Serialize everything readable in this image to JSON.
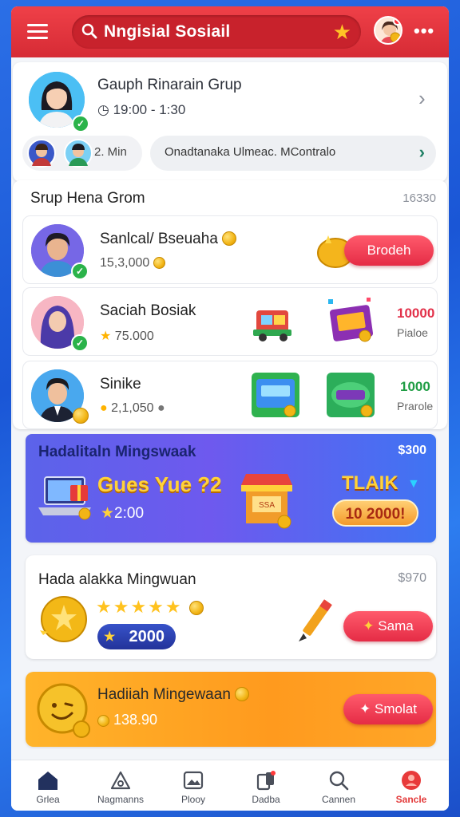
{
  "header": {
    "search_text": "Nngisial Sosiail"
  },
  "group": {
    "title": "Gauph Rinarain Grup",
    "time": "19:00 - 1:30",
    "mini_text": "2. Min",
    "notice": "Onadtanaka Ulmeac. MContralo"
  },
  "ranking": {
    "title": "Srup Hena Grom",
    "count": "16330",
    "rows": [
      {
        "name": "Sanlcal/ Bseuaha",
        "points": "15,3,000",
        "button": "Brodeh"
      },
      {
        "name": "Saciah Bosiak",
        "points": "75.000",
        "prize_value": "10000",
        "prize_label": "Pialoe"
      },
      {
        "name": "Sinike",
        "points": "2,1,050",
        "prize_value": "1000",
        "prize_label": "Prarole"
      }
    ]
  },
  "banner": {
    "title": "Hadalitaln Mingswaak",
    "value": "$300",
    "big_text": "Gues Yue ?2",
    "points": "2:00",
    "tag": "TLAIK",
    "pill": "10 2000!",
    "badge_text": "SSA"
  },
  "weekly": {
    "title": "Hada alakka Mingwuan",
    "value": "$970",
    "stars": "★★★★★",
    "amount": "2000",
    "button": "Sama"
  },
  "reward": {
    "title": "Hadiiah Mingewaan",
    "points": "138.90",
    "button": "Smolat"
  },
  "nav": [
    {
      "label": "Grlea",
      "icon": "home-icon"
    },
    {
      "label": "Nagmanns",
      "icon": "triangle-icon"
    },
    {
      "label": "Plooy",
      "icon": "image-icon"
    },
    {
      "label": "Dadba",
      "icon": "card-icon"
    },
    {
      "label": "Cannen",
      "icon": "search-icon"
    },
    {
      "label": "Sancle",
      "icon": "profile-icon"
    }
  ],
  "colors": {
    "header_red": "#e43640",
    "accent_red": "#e52c46",
    "banner_blue": "#5b63ea",
    "orange": "#ff9a1e",
    "green": "#2bb34a"
  }
}
